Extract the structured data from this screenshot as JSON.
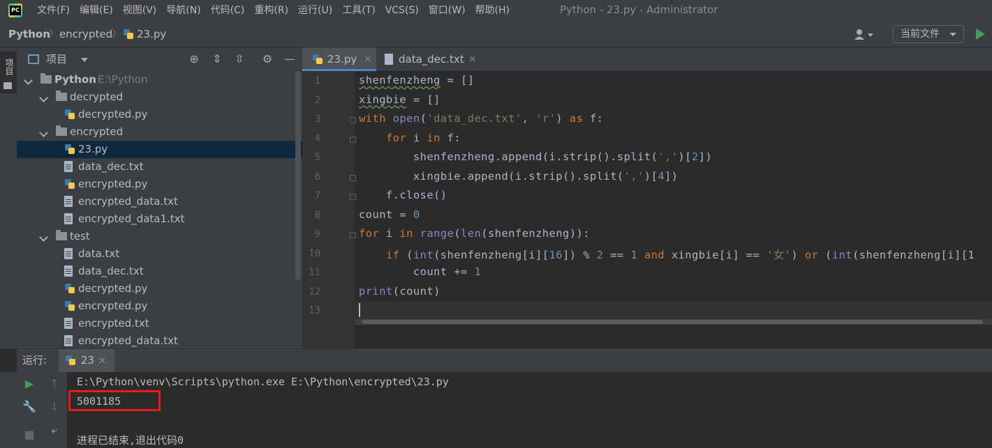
{
  "menu": {
    "items": [
      "文件(F)",
      "编辑(E)",
      "视图(V)",
      "导航(N)",
      "代码(C)",
      "重构(R)",
      "运行(U)",
      "工具(T)",
      "VCS(S)",
      "窗口(W)",
      "帮助(H)"
    ],
    "window_title": "Python - 23.py - Administrator"
  },
  "breadcrumb": [
    "Python",
    "encrypted",
    "23.py"
  ],
  "toolbar": {
    "run_config": "当前文件"
  },
  "project": {
    "title": "项目",
    "side_tab": "项目",
    "tree": [
      {
        "label": "Python",
        "hint": "E:\\Python",
        "type": "folder",
        "level": 0
      },
      {
        "label": "decrypted",
        "type": "folder",
        "level": 1
      },
      {
        "label": "decrypted.py",
        "type": "py",
        "level": 2
      },
      {
        "label": "encrypted",
        "type": "folder",
        "level": 1
      },
      {
        "label": "23.py",
        "type": "py",
        "level": 2,
        "selected": true
      },
      {
        "label": "data_dec.txt",
        "type": "txt",
        "level": 2
      },
      {
        "label": "encrypted.py",
        "type": "py",
        "level": 2
      },
      {
        "label": "encrypted_data.txt",
        "type": "txt",
        "level": 2
      },
      {
        "label": "encrypted_data1.txt",
        "type": "txt",
        "level": 2
      },
      {
        "label": "test",
        "type": "folder",
        "level": 1
      },
      {
        "label": "data.txt",
        "type": "txt",
        "level": 2
      },
      {
        "label": "data_dec.txt",
        "type": "txt",
        "level": 2
      },
      {
        "label": "decrypted.py",
        "type": "py",
        "level": 2
      },
      {
        "label": "encrypted.py",
        "type": "py",
        "level": 2
      },
      {
        "label": "encrypted.txt",
        "type": "txt",
        "level": 2
      },
      {
        "label": "encrypted_data.txt",
        "type": "txt",
        "level": 2
      }
    ]
  },
  "editor": {
    "tabs": [
      "23.py",
      "data_dec.txt"
    ],
    "active_tab": "23.py",
    "line_numbers": [
      "1",
      "2",
      "3",
      "4",
      "5",
      "6",
      "7",
      "8",
      "9",
      "10",
      "11",
      "12",
      "13"
    ]
  },
  "run": {
    "label": "运行:",
    "tab": "23",
    "command": "E:\\Python\\venv\\Scripts\\python.exe E:\\Python\\encrypted\\23.py",
    "output": "5001185",
    "exit_message": "进程已结束,退出代码0"
  },
  "colors": {
    "highlight_box": "#e51c1c",
    "keyword": "#cc7832",
    "string": "#6a8759",
    "number": "#6897bb"
  }
}
